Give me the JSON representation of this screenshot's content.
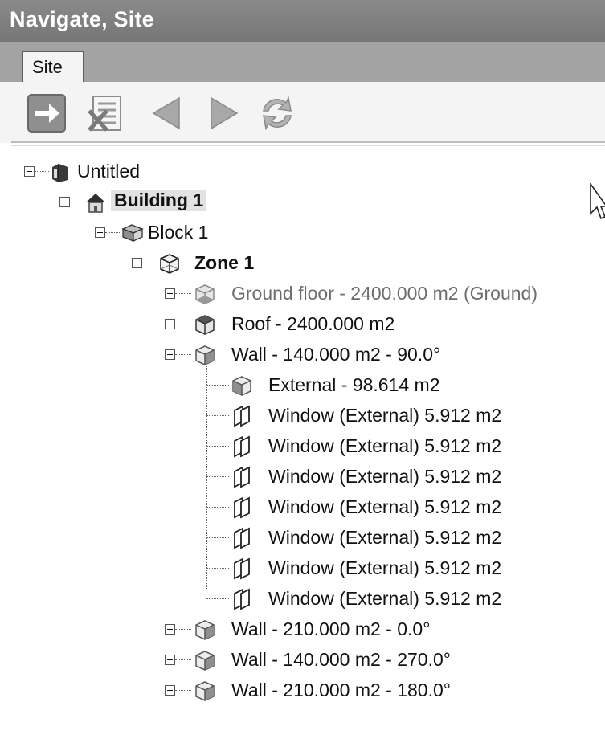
{
  "window": {
    "title": "Navigate, Site"
  },
  "tabs": [
    {
      "label": "Site"
    }
  ],
  "toolbar": {
    "buttons": [
      {
        "icon": "arrow-right-icon"
      },
      {
        "icon": "delete-list-icon"
      },
      {
        "icon": "back-triangle-icon"
      },
      {
        "icon": "forward-triangle-icon"
      },
      {
        "icon": "refresh-icon"
      }
    ]
  },
  "tree": {
    "root": {
      "label": "Untitled"
    },
    "building": {
      "label": "Building 1"
    },
    "block": {
      "label": "Block 1"
    },
    "zone": {
      "label": "Zone 1"
    },
    "surfaces": [
      {
        "label": "Ground floor - 2400.000 m2 (Ground)"
      },
      {
        "label": "Roof - 2400.000 m2"
      },
      {
        "label": "Wall - 140.000 m2 - 90.0°"
      }
    ],
    "wall_children": [
      {
        "label": "External - 98.614 m2"
      },
      {
        "label": "Window (External) 5.912 m2"
      },
      {
        "label": "Window (External) 5.912 m2"
      },
      {
        "label": "Window (External) 5.912 m2"
      },
      {
        "label": "Window (External) 5.912 m2"
      },
      {
        "label": "Window (External) 5.912 m2"
      },
      {
        "label": "Window (External) 5.912 m2"
      },
      {
        "label": "Window (External) 5.912 m2"
      }
    ],
    "other_walls": [
      {
        "label": "Wall - 210.000 m2 - 0.0°"
      },
      {
        "label": "Wall - 140.000 m2 - 270.0°"
      },
      {
        "label": "Wall - 210.000 m2 - 180.0°"
      }
    ]
  }
}
